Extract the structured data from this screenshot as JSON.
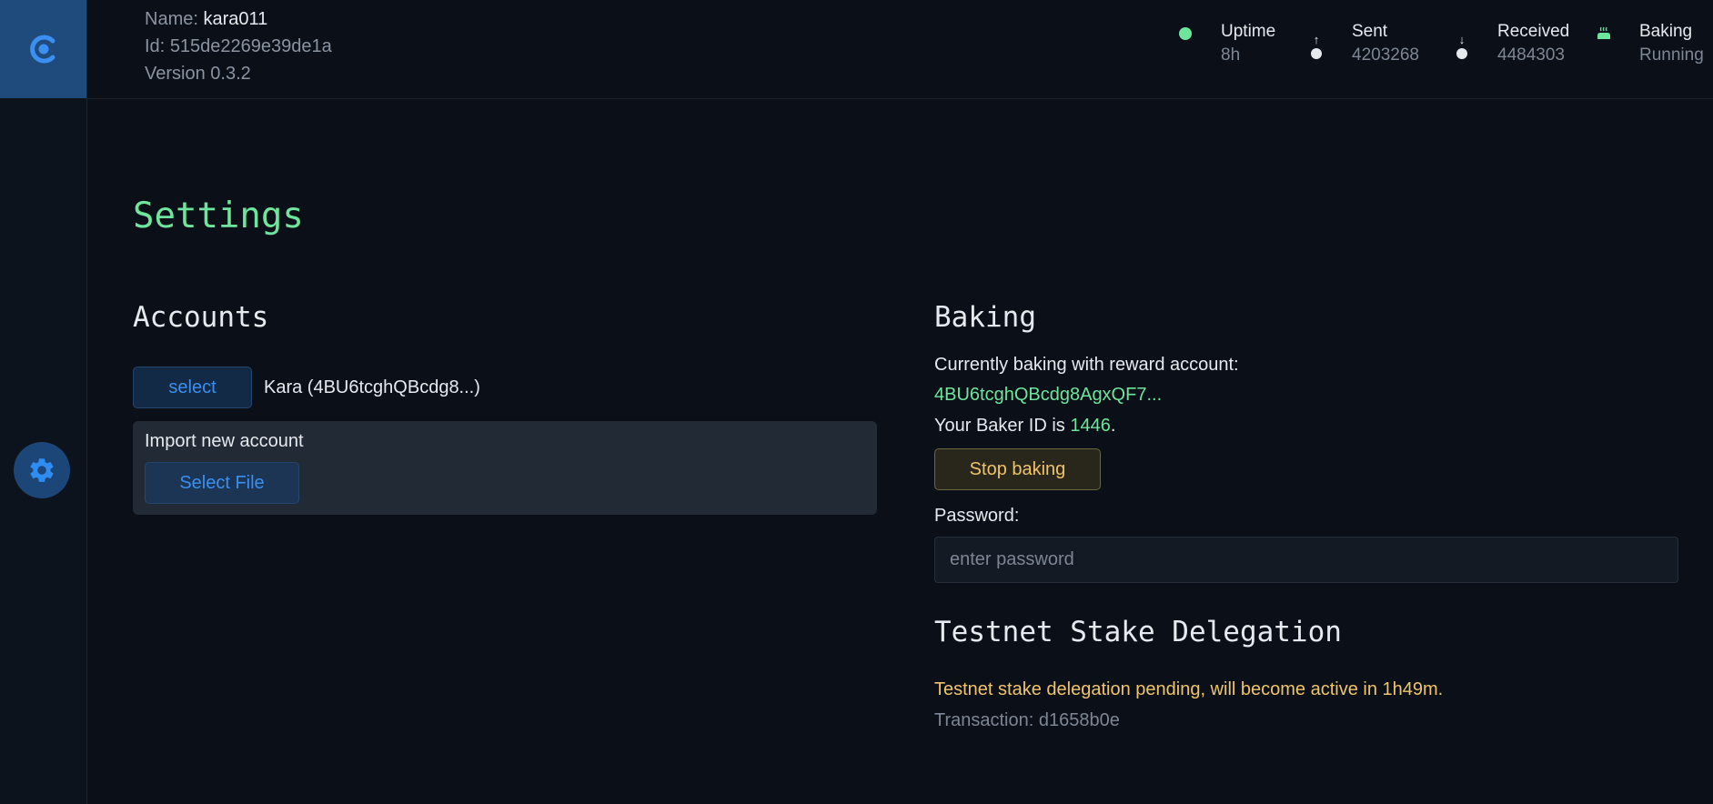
{
  "node": {
    "name_label": "Name:",
    "name_value": "kara011",
    "id_label": "Id:",
    "id_value": "515de2269e39de1a",
    "version_label": "Version",
    "version_value": "0.3.2"
  },
  "stats": {
    "uptime": {
      "label": "Uptime",
      "value": "8h",
      "color": "#6ee59c"
    },
    "sent": {
      "label": "Sent",
      "value": "4203268",
      "arrow": "↑"
    },
    "received": {
      "label": "Received",
      "value": "4484303",
      "arrow": "↓"
    },
    "baking": {
      "label": "Baking",
      "value": "Running"
    }
  },
  "page": {
    "title": "Settings"
  },
  "accounts": {
    "heading": "Accounts",
    "select_label": "select",
    "current_account": "Kara (4BU6tcghQBcdg8...)",
    "import_label": "Import new account",
    "select_file_label": "Select File"
  },
  "baking": {
    "heading": "Baking",
    "reward_text": "Currently baking with reward account:",
    "reward_account": "4BU6tcghQBcdg8AgxQF7...",
    "baker_id_prefix": "Your Baker ID is",
    "baker_id": "1446",
    "baker_id_suffix": ".",
    "stop_label": "Stop baking",
    "password_label": "Password:",
    "password_placeholder": "enter password"
  },
  "delegation": {
    "heading": "Testnet Stake Delegation",
    "pending_text": "Testnet stake delegation pending, will become active in 1h49m.",
    "transaction_text": "Transaction: d1658b0e"
  },
  "colors": {
    "accent_green": "#6ee59c",
    "accent_blue": "#3a8ff0",
    "warning_gold": "#efc46a"
  }
}
